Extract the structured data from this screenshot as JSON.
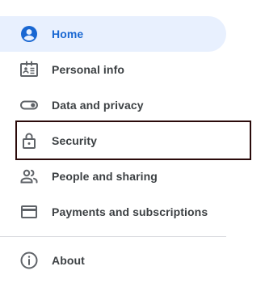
{
  "nav": {
    "items": [
      {
        "label": "Home",
        "icon": "account-circle-icon",
        "active": true
      },
      {
        "label": "Personal info",
        "icon": "id-card-icon"
      },
      {
        "label": "Data and privacy",
        "icon": "toggle-icon"
      },
      {
        "label": "Security",
        "icon": "lock-icon",
        "focused": true
      },
      {
        "label": "People and sharing",
        "icon": "people-icon"
      },
      {
        "label": "Payments and subscriptions",
        "icon": "credit-card-icon"
      },
      {
        "label": "About",
        "icon": "info-icon"
      }
    ]
  },
  "colors": {
    "active_background": "#e8f0fe",
    "active_accent": "#1967d2",
    "text": "#3c4043",
    "icon": "#5f6368",
    "divider": "#dadce0",
    "focus_border": "#2a0a0a"
  }
}
